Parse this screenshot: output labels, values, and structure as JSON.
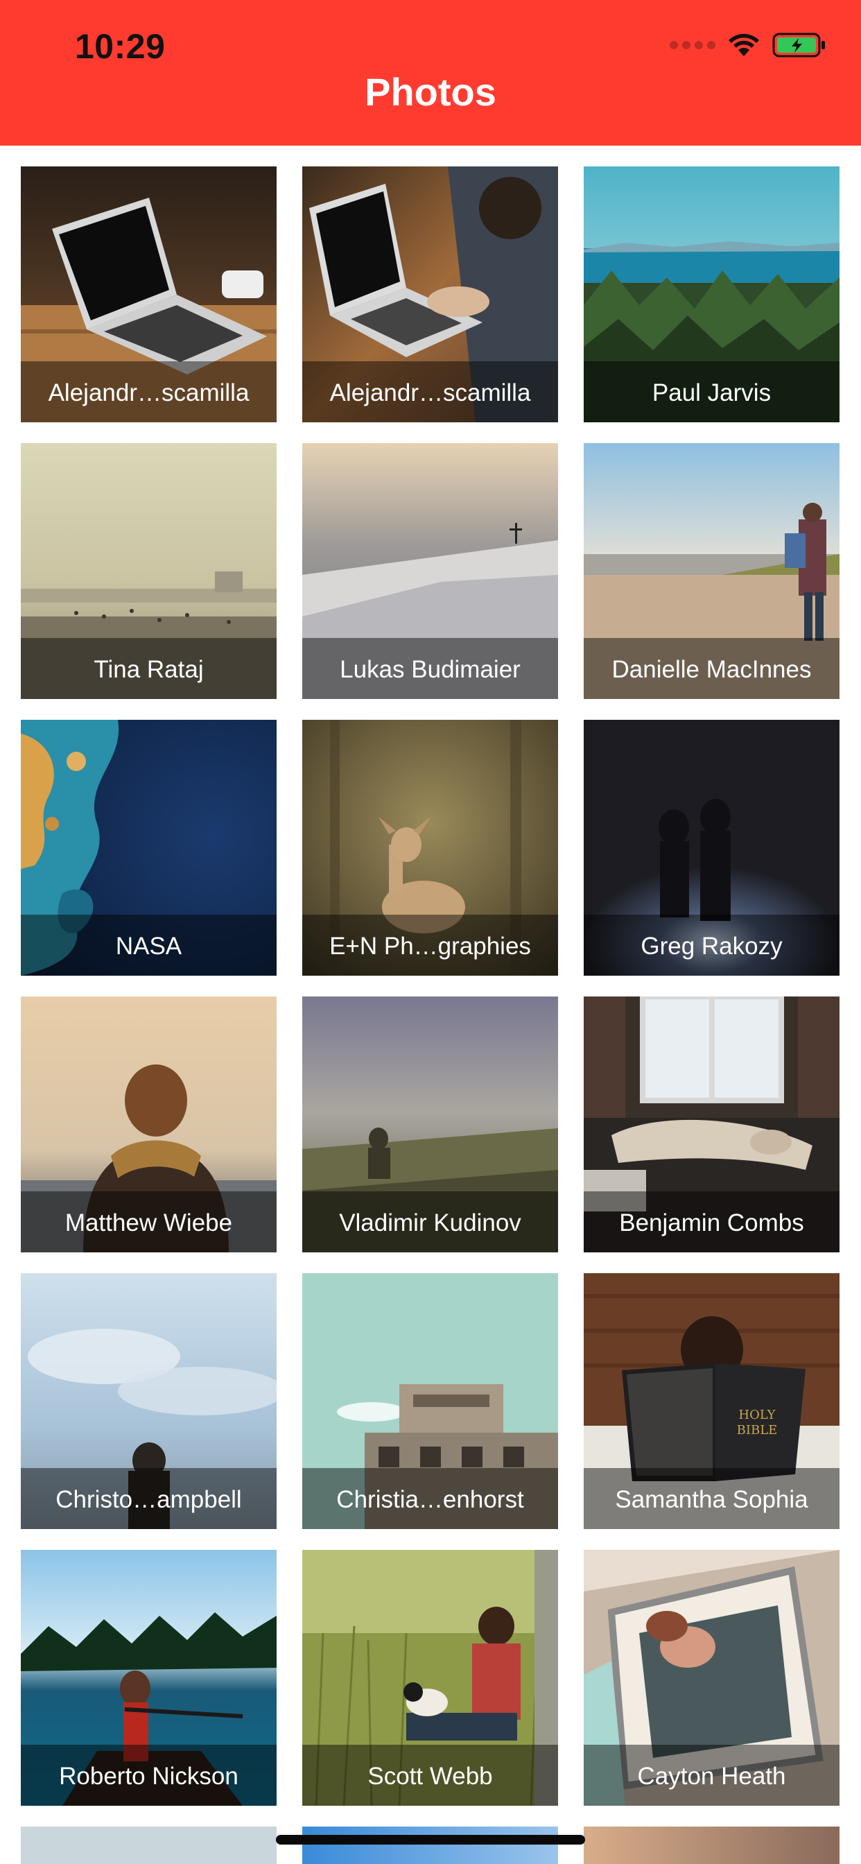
{
  "status_bar": {
    "time": "10:29",
    "icons": [
      "cellular-dots-icon",
      "wifi-icon",
      "battery-charging-icon"
    ],
    "battery_color": "#33c759"
  },
  "header": {
    "title": "Photos",
    "background_color": "#ff3b30"
  },
  "photos": [
    {
      "author": "Alejandr…scamilla",
      "scene": "laptop-on-desk"
    },
    {
      "author": "Alejandr…scamilla",
      "scene": "person-typing-laptop"
    },
    {
      "author": "Paul Jarvis",
      "scene": "coast-forest"
    },
    {
      "author": "Tina Rataj",
      "scene": "hazy-beach"
    },
    {
      "author": "Lukas Budimaier",
      "scene": "snowy-summit-cross"
    },
    {
      "author": "Danielle MacInnes",
      "scene": "father-child-beach"
    },
    {
      "author": "NASA",
      "scene": "earth-from-space"
    },
    {
      "author": "E+N Ph…graphies",
      "scene": "fawn-in-forest"
    },
    {
      "author": "Greg Rakozy",
      "scene": "couple-night-light"
    },
    {
      "author": "Matthew Wiebe",
      "scene": "man-with-scarf"
    },
    {
      "author": "Vladimir Kudinov",
      "scene": "misty-hill-person"
    },
    {
      "author": "Benjamin Combs",
      "scene": "woman-on-couch-window"
    },
    {
      "author": "Christo…ampbell",
      "scene": "sky-person-back"
    },
    {
      "author": "Christia…enhorst",
      "scene": "concrete-bunker"
    },
    {
      "author": "Samantha Sophia",
      "scene": "child-reading-bible"
    },
    {
      "author": "Roberto Nickson",
      "scene": "woman-in-canoe"
    },
    {
      "author": "Scott Webb",
      "scene": "man-with-dog-grass"
    },
    {
      "author": "Cayton Heath",
      "scene": "woman-in-van-window"
    }
  ],
  "partial_row": [
    {
      "scene": "partial-1"
    },
    {
      "scene": "partial-2"
    },
    {
      "scene": "partial-3"
    }
  ]
}
